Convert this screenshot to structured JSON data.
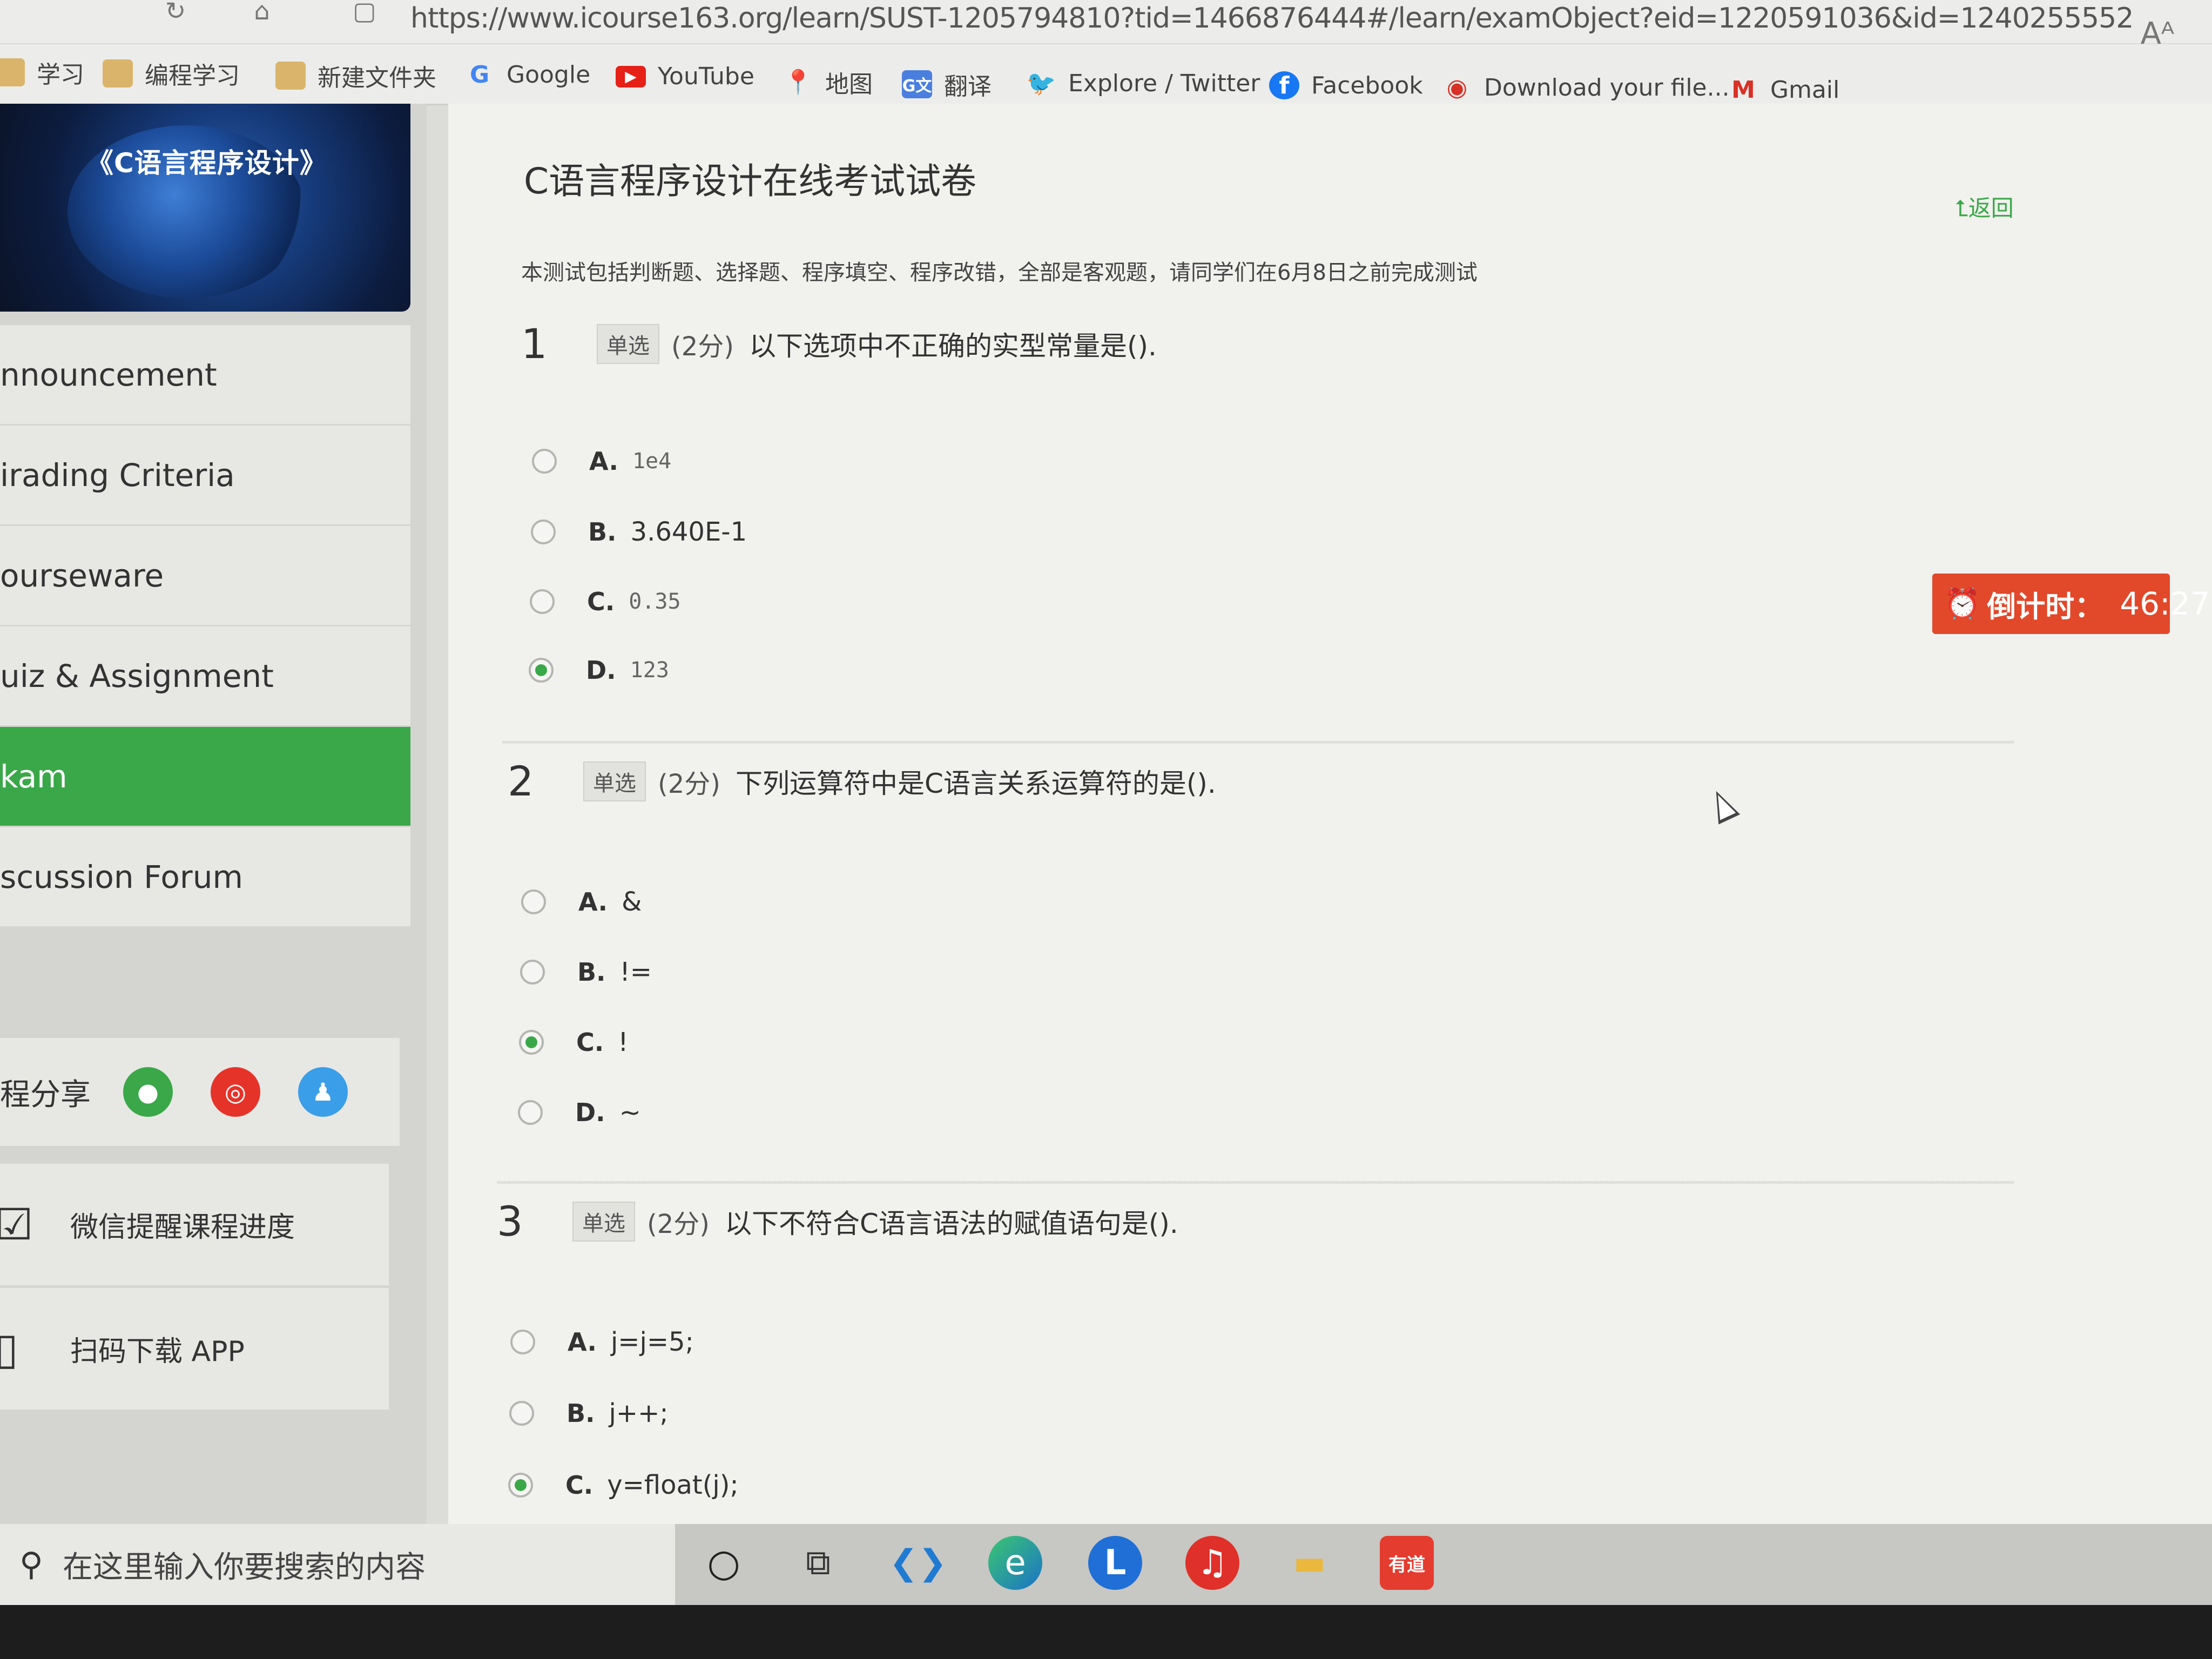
{
  "browser": {
    "url": "https://www.icourse163.org/learn/SUST-1205794810?tid=1466876444#/learn/examObject?eid=1220591036&id=1240255552",
    "bookmarks": [
      "学习",
      "编程学习",
      "新建文件夹",
      "Google",
      "YouTube",
      "地图",
      "翻译",
      "Explore / Twitter",
      "Facebook",
      "Download your file...",
      "Gmail"
    ]
  },
  "sidebar": {
    "banner_title": "《C语言程序设计》",
    "items": [
      {
        "label": "nnouncement"
      },
      {
        "label": "irading Criteria"
      },
      {
        "label": "ourseware"
      },
      {
        "label": "uiz & Assignment"
      },
      {
        "label": "kam"
      },
      {
        "label": "scussion Forum"
      }
    ],
    "share_label": "程分享",
    "wechat_remind": "微信提醒课程进度",
    "scan_app": "扫码下载 APP"
  },
  "exam": {
    "title": "C语言程序设计在线考试试卷",
    "back": "返回",
    "description": "本测试包括判断题、选择题、程序填空、程序改错，全部是客观题，请同学们在6月8日之前完成测试",
    "questions": [
      {
        "num": "1",
        "type": "单选",
        "score": "(2分)",
        "text": "以下选项中不正确的实型常量是().",
        "options": [
          {
            "letter": "A.",
            "text": "1e4"
          },
          {
            "letter": "B.",
            "text": "3.640E-1"
          },
          {
            "letter": "C.",
            "text": "0.35"
          },
          {
            "letter": "D.",
            "text": "123"
          }
        ],
        "selected": "D"
      },
      {
        "num": "2",
        "type": "单选",
        "score": "(2分)",
        "text": "下列运算符中是C语言关系运算符的是().",
        "options": [
          {
            "letter": "A.",
            "text": "&"
          },
          {
            "letter": "B.",
            "text": "!="
          },
          {
            "letter": "C.",
            "text": "!"
          },
          {
            "letter": "D.",
            "text": "~"
          }
        ],
        "selected": "C"
      },
      {
        "num": "3",
        "type": "单选",
        "score": "(2分)",
        "text": "以下不符合C语言语法的赋值语句是().",
        "options": [
          {
            "letter": "A.",
            "text": "j=j=5;"
          },
          {
            "letter": "B.",
            "text": "j++;"
          },
          {
            "letter": "C.",
            "text": "y=float(j);"
          }
        ],
        "selected": "C"
      }
    ]
  },
  "timer": {
    "label": "倒计时：",
    "time": "46:27"
  },
  "taskbar": {
    "search_placeholder": "在这里输入你要搜索的内容",
    "apps": [
      "cortana",
      "task-view",
      "vscode",
      "edge",
      "lenovo",
      "netease-music",
      "file-explorer",
      "youdao"
    ],
    "youdao_label": "有道"
  },
  "colors": {
    "accent": "#3aa848",
    "timer": "#e1492a"
  }
}
